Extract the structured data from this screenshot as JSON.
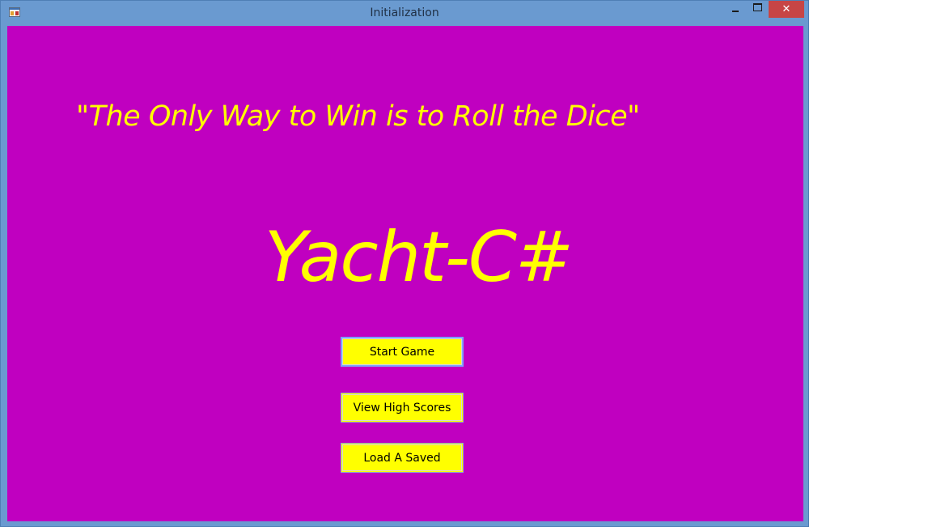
{
  "window": {
    "title": "Initialization",
    "controls": {
      "minimize": "minimize",
      "maximize": "maximize",
      "close_label": "✕"
    }
  },
  "main": {
    "tagline": "\"The Only Way to Win is to Roll the Dice\"",
    "game_title": "Yacht-C#",
    "buttons": {
      "start": "Start Game",
      "high_scores": "View High Scores",
      "load_saved": "Load A Saved"
    }
  },
  "colors": {
    "background": "#c000c0",
    "text_accent": "#ffff00",
    "button_fill": "#ffff00",
    "titlebar": "#6a9ad0",
    "close_button": "#c74545"
  },
  "icons": {
    "app": "app-window-icon",
    "minimize": "minimize-icon",
    "maximize": "maximize-icon",
    "close": "close-icon"
  }
}
